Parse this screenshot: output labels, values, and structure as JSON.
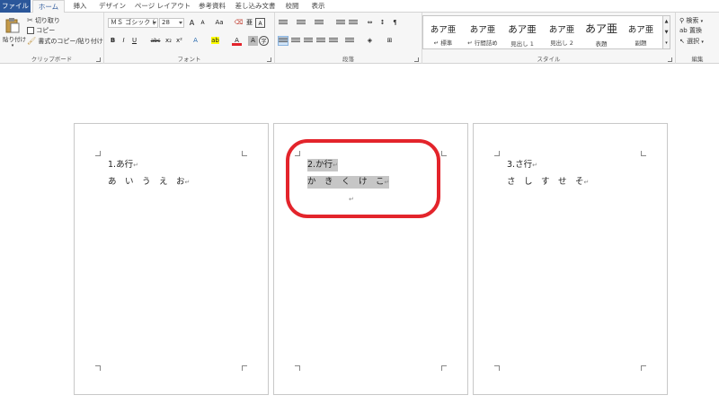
{
  "tabs": [
    "ファイル",
    "ホーム",
    "挿入",
    "デザイン",
    "ページ レイアウト",
    "参考資料",
    "差し込み文書",
    "校閲",
    "表示"
  ],
  "clipboard": {
    "paste": "貼り付け",
    "cut": "切り取り",
    "copy": "コピー",
    "format_painter": "書式のコピー/貼り付け",
    "label": "クリップボード"
  },
  "font": {
    "name": "ＭＳ ゴシック (",
    "size": "28",
    "label": "フォント",
    "grow": "A",
    "shrink": "A",
    "case": "Aa",
    "bold": "B",
    "italic": "I",
    "underline": "U",
    "strike": "abc",
    "sub": "x₂",
    "sup": "x²",
    "font_color": "A"
  },
  "paragraph": {
    "label": "段落"
  },
  "styles": {
    "label": "スタイル",
    "items": [
      {
        "sample": "あア亜",
        "name": "↵ 標準"
      },
      {
        "sample": "あア亜",
        "name": "↵ 行間詰め"
      },
      {
        "sample": "あア亜",
        "name": "見出し 1"
      },
      {
        "sample": "あア亜",
        "name": "見出し 2"
      },
      {
        "sample": "あア亜",
        "name": "表題"
      },
      {
        "sample": "あア亜",
        "name": "副題"
      }
    ]
  },
  "editing": {
    "label": "編集",
    "find": "検索",
    "replace": "置換",
    "select": "選択"
  },
  "pages": [
    {
      "heading": "1.あ行",
      "chars": "あ　い　う　え　お"
    },
    {
      "heading": "2.か行",
      "chars": "か　き　く　け　こ"
    },
    {
      "heading": "3.さ行",
      "chars": "さ　し　す　せ　そ"
    }
  ],
  "colors": {
    "file_tab": "#2b579a",
    "highlight": "#e3242b",
    "selection": "#c6c6c6"
  }
}
